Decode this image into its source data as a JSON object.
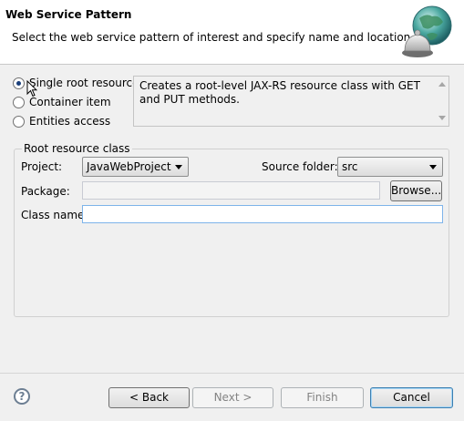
{
  "header": {
    "title": "Web Service Pattern",
    "description": "Select the web service pattern of interest and specify name and location.",
    "image_icon": "globe-wizard-icon"
  },
  "patterns": {
    "options": [
      {
        "label": "Single root resource",
        "selected": true
      },
      {
        "label": "Container item",
        "selected": false
      },
      {
        "label": "Entities access",
        "selected": false
      }
    ],
    "description": "Creates a root-level JAX-RS resource class with GET and PUT methods."
  },
  "root_resource": {
    "legend": "Root resource class",
    "project_label": "Project:",
    "project_value": "JavaWebProject",
    "source_folder_label": "Source folder:",
    "source_folder_value": "src",
    "package_label": "Package:",
    "package_value": "",
    "browse_label": "Browse...",
    "class_name_label": "Class name:",
    "class_name_value": ""
  },
  "buttons": {
    "back": "< Back",
    "next": "Next >",
    "finish": "Finish",
    "cancel": "Cancel",
    "help_icon": "help-icon"
  },
  "colors": {
    "header_bg": "#ffffff",
    "dialog_bg": "#f0f0f0",
    "focus_border": "#7eb4ea"
  }
}
